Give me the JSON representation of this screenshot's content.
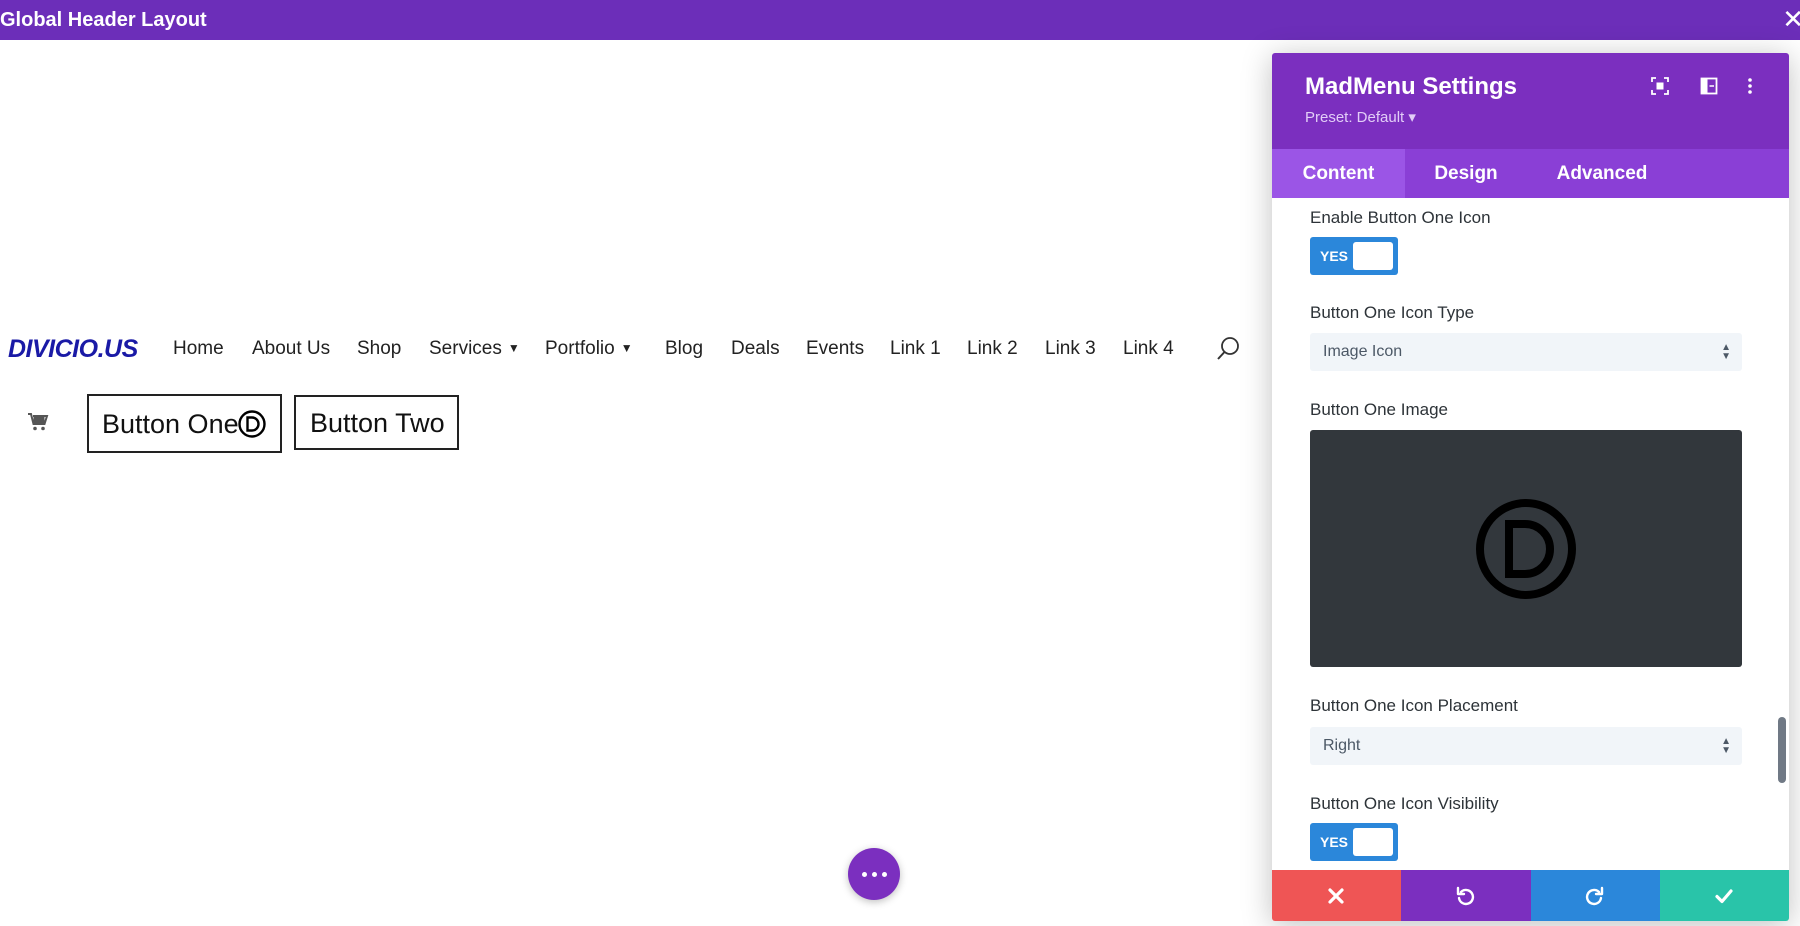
{
  "header": {
    "title": "Global Header Layout",
    "close_glyph": "✕"
  },
  "preview": {
    "logo": "DIVICIO.US",
    "nav": [
      {
        "label": "Home",
        "dropdown": false
      },
      {
        "label": "About Us",
        "dropdown": false
      },
      {
        "label": "Shop",
        "dropdown": false
      },
      {
        "label": "Services",
        "dropdown": true
      },
      {
        "label": "Portfolio",
        "dropdown": true
      },
      {
        "label": "Blog",
        "dropdown": false
      },
      {
        "label": "Deals",
        "dropdown": false
      },
      {
        "label": "Events",
        "dropdown": false
      },
      {
        "label": "Link 1",
        "dropdown": false
      },
      {
        "label": "Link 2",
        "dropdown": false
      },
      {
        "label": "Link 3",
        "dropdown": false
      },
      {
        "label": "Link 4",
        "dropdown": false
      }
    ],
    "button_one": "Button One",
    "button_two": "Button Two",
    "icons": {
      "search": "search-icon",
      "cart": "cart-icon",
      "button_one_icon": "divi-d-icon",
      "fab": "more-dots-icon"
    }
  },
  "panel": {
    "title": "MadMenu Settings",
    "preset": "Preset: Default ▾",
    "header_icons": [
      "fullscreen-icon",
      "split-layout-icon",
      "more-vertical-icon"
    ],
    "tabs": [
      {
        "label": "Content",
        "active": true
      },
      {
        "label": "Design",
        "active": false
      },
      {
        "label": "Advanced",
        "active": false
      }
    ],
    "fields": {
      "enable_icon_label": "Enable Button One Icon",
      "enable_icon_value": "YES",
      "icon_type_label": "Button One Icon Type",
      "icon_type_value": "Image Icon",
      "image_label": "Button One Image",
      "placement_label": "Button One Icon Placement",
      "placement_value": "Right",
      "visibility_label": "Button One Icon Visibility",
      "visibility_value": "YES"
    },
    "footer": [
      {
        "name": "discard",
        "icon": "close-icon",
        "color": "#ef5555"
      },
      {
        "name": "undo",
        "icon": "undo-icon",
        "color": "#7b2fbf"
      },
      {
        "name": "redo",
        "icon": "redo-icon",
        "color": "#2b87da"
      },
      {
        "name": "save",
        "icon": "check-icon",
        "color": "#29c4a9"
      }
    ]
  },
  "colors": {
    "header_purple": "#6c2eb9",
    "panel_purple": "#7b2fbf",
    "tab_purple": "#8a3fd6",
    "toggle_blue": "#2b87da",
    "logo_blue": "#1a1aa6"
  }
}
